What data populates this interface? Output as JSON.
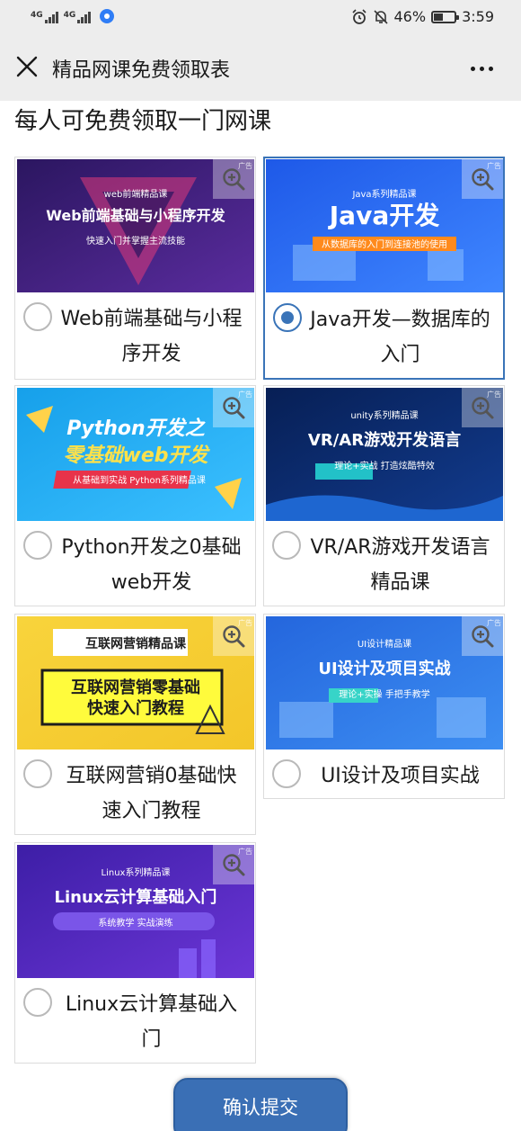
{
  "status_bar": {
    "net1": "4G",
    "net2": "4G",
    "battery_level": "46%",
    "battery_fraction": 0.46,
    "time": "3:59",
    "icons": [
      "signal-icon",
      "browser-icon",
      "alarm-icon",
      "mute-icon",
      "battery-icon"
    ]
  },
  "nav": {
    "title": "精品网课免费领取表",
    "close_icon": "close-icon",
    "more_icon": "more-icon"
  },
  "subtitle": "每人可免费领取一门网课",
  "courses": [
    {
      "label": "Web前端基础与小程序开发",
      "selected": false,
      "banner": {
        "tag": "web前端精品课",
        "headline": "Web前端基础与小程序开发",
        "sub": "快速入门并掌握主流技能",
        "bg": "#3a1e6e"
      }
    },
    {
      "label": "Java开发—数据库的入门",
      "selected": true,
      "banner": {
        "tag": "Java系列精品课",
        "headline": "Java开发",
        "sub": "从数据库的入门到连接池的使用",
        "bg": "#2f6ae8"
      }
    },
    {
      "label": "Python开发之0基础web开发",
      "selected": false,
      "banner": {
        "tag": "",
        "headline": "Python开发之",
        "headline2": "零基础web开发",
        "sub": "从基础到实战 Python系列精品课",
        "bg": "#27a9ea"
      }
    },
    {
      "label": "VR/AR游戏开发语言精品课",
      "selected": false,
      "banner": {
        "tag": "unity系列精品课",
        "headline": "VR/AR游戏开发语言",
        "sub": "理论+实战  打造炫酷特效",
        "bg": "#0c2a6a"
      }
    },
    {
      "label": "互联网营销0基础快速入门教程",
      "selected": false,
      "banner": {
        "tag": "互联网营销精品课",
        "headline": "互联网营销零基础",
        "headline2": "快速入门教程",
        "sub": "",
        "bg": "#f6d53c"
      }
    },
    {
      "label": "UI设计及项目实战",
      "selected": false,
      "banner": {
        "tag": "UI设计精品课",
        "headline": "UI设计及项目实战",
        "sub": "理论+实操  手把手教学",
        "bg": "#2f78e0"
      }
    },
    {
      "label": "Linux云计算基础入门",
      "selected": false,
      "banner": {
        "tag": "Linux系列精品课",
        "headline": "Linux云计算基础入门",
        "sub": "系统教学  实战演练",
        "bg": "#5b2bc9"
      }
    }
  ],
  "submit_label": "确认提交",
  "ad_tag": "广告",
  "zoom_icon": "zoom-in-icon",
  "accent_color": "#3a74b8"
}
